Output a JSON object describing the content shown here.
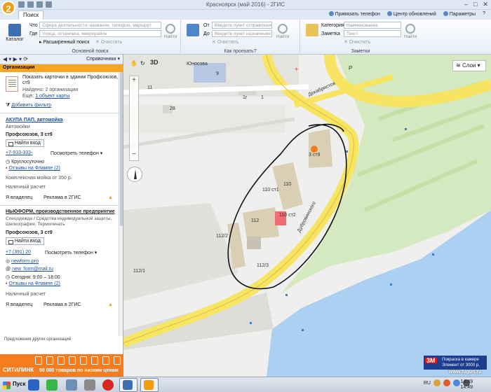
{
  "window": {
    "title": "Красноярск (май 2016) - 2ГИС",
    "logo": "2"
  },
  "tabs": [
    "Поиск"
  ],
  "tabbar_right": [
    "Привязать телефон",
    "Центр обновлений",
    "Параметры"
  ],
  "ribbon": {
    "catalog_label": "Каталог",
    "what_label": "Что",
    "what_placeholder": "Сфера деятельности, название, телефон, маршрут",
    "where_label": "Где",
    "where_placeholder": "Улица, остановка, микрорайон",
    "find_label": "Найти",
    "advanced_search": "Расширенный поиск",
    "clear_label": "Очистить",
    "group_basic": "Основной поиск",
    "from_label": "От",
    "from_placeholder": "Введите пункт отправления",
    "to_label": "До",
    "to_placeholder": "Введите пункт назначения",
    "group_route": "Как проехать?",
    "category_label": "Категория",
    "category_placeholder": "Наименование",
    "note_label": "Заметка",
    "note_placeholder": "Текст",
    "group_notes": "Заметки"
  },
  "left": {
    "nav_ref": "Справочники",
    "header": "Организации",
    "summary": {
      "show_cards": "Показать карточки в здании Профсоюзов, 3",
      "show_cards_2": "ст9",
      "found": "Найдено: 2 организации",
      "more_prefix": "Ещё:",
      "more_link": "1 объект карты",
      "add_filter": "Добавить фильтр"
    },
    "orgs": [
      {
        "name": "АКУПА ПАП, автомойка",
        "category": "Автомойки",
        "address": "Профсоюзов, 3 ст9",
        "entrance": "Найти вход",
        "phone": "+7-933-333-",
        "phone_btn": "Посмотреть телефон",
        "hours": "Круглосуточно",
        "reviews": "Отзывы на Флампе (2)",
        "description": "Комплексная мойка от 350 р.",
        "payment": "Наличный расчет",
        "owner": "Я владелец",
        "ad": "Реклама в 2ГИС"
      },
      {
        "name": "НЬЮФОРМ, производственное предприятие",
        "category": "Спецодежда / Средства индивидуальной защиты,",
        "category_2": "Шелкография, Термопечать",
        "address": "Профсоюзов, 3 ст9",
        "entrance": "Найти вход",
        "phone": "+7 (391) 20",
        "phone_btn": "Посмотреть телефон",
        "site": "newform.pro",
        "email": "new_form@mail.ru",
        "hours": "Сегодня: 9:00 – 18:00",
        "reviews": "Отзывы на Флампе (2)",
        "payment": "Наличный расчет",
        "owner": "Я владелец",
        "ad": "Реклама в 2ГИС"
      }
    ],
    "other_orgs": "Предложения других организаций",
    "banner": {
      "brand": "СИТИЛИНК",
      "slogan": "50 000 товаров по низким ценам"
    }
  },
  "map": {
    "view_3d": "3D",
    "layers": "Слои",
    "labels": {
      "street1": "Юносова",
      "street2": "Декабристов",
      "street3": "Дубровинского",
      "b9": "9",
      "b11": "11",
      "b28": "28",
      "b1g": "1г",
      "b1": "1",
      "b3st9": "3 ст9",
      "b110st1": "110 ст1",
      "b110": "110",
      "b110st2": "110 ст2",
      "b112": "112",
      "b112_2": "112/2",
      "b112_3": "112/3",
      "b112_1": "112/1"
    },
    "ad_3m": {
      "brand": "3M",
      "line1": "Покраска в камере",
      "line2": "Элемент от 3000 р."
    },
    "watermark": "www.tugun.ru"
  },
  "taskbar": {
    "start": "Пуск",
    "lang": "RU",
    "time": "14:49",
    "date": "14:49"
  },
  "colors": {
    "accent": "#f6a623",
    "map_road": "#f7e463",
    "map_water": "#a9cdf0",
    "map_green": "#cfe7b8"
  }
}
